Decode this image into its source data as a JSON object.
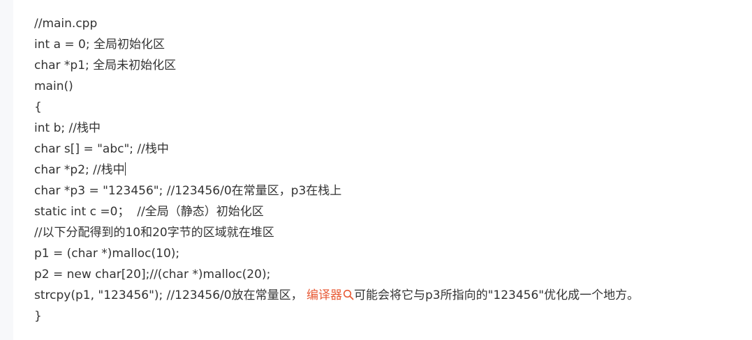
{
  "code": {
    "lines": [
      "//main.cpp",
      "int a = 0; 全局初始化区",
      "char *p1; 全局未初始化区",
      "main()",
      "{",
      "int b; //栈中",
      "char s[] = \"abc\"; //栈中",
      "char *p2; //栈中",
      "char *p3 = \"123456\"; //123456/0在常量区，p3在栈上",
      "static int c =0；  //全局（静态）初始化区",
      "//以下分配得到的10和20字节的区域就在堆区",
      "p1 = (char *)malloc(10);",
      "p2 = new char[20];//(char *)malloc(20);"
    ],
    "strcpy_line": {
      "before": "strcpy(p1, \"123456\"); //123456/0放在常量区， ",
      "link": "编译器",
      "link_icon": "search-icon",
      "after": "可能会将它与p3所指向的\"123456\"优化成一个地方。"
    },
    "closing": "}"
  },
  "colors": {
    "text": "#333333",
    "link": "#e85a35",
    "gutter": "#f7f8fa"
  }
}
